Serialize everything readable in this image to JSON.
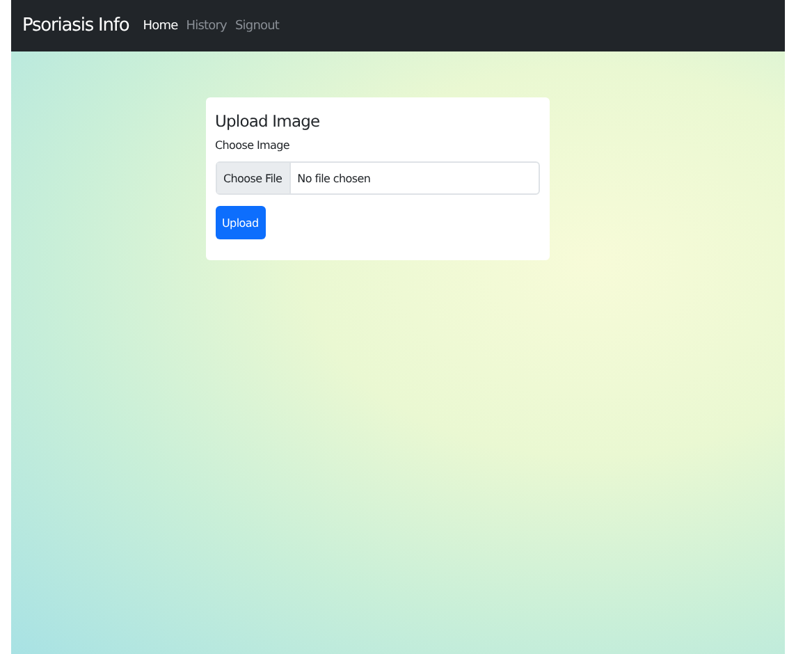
{
  "navbar": {
    "brand": "Psoriasis Info",
    "links": [
      {
        "label": "Home",
        "selected": true
      },
      {
        "label": "History",
        "selected": false
      },
      {
        "label": "Signout",
        "selected": false
      }
    ]
  },
  "card": {
    "title": "Upload Image",
    "label": "Choose Image",
    "file_button": "Choose File",
    "file_status": "No file chosen",
    "submit": "Upload"
  }
}
